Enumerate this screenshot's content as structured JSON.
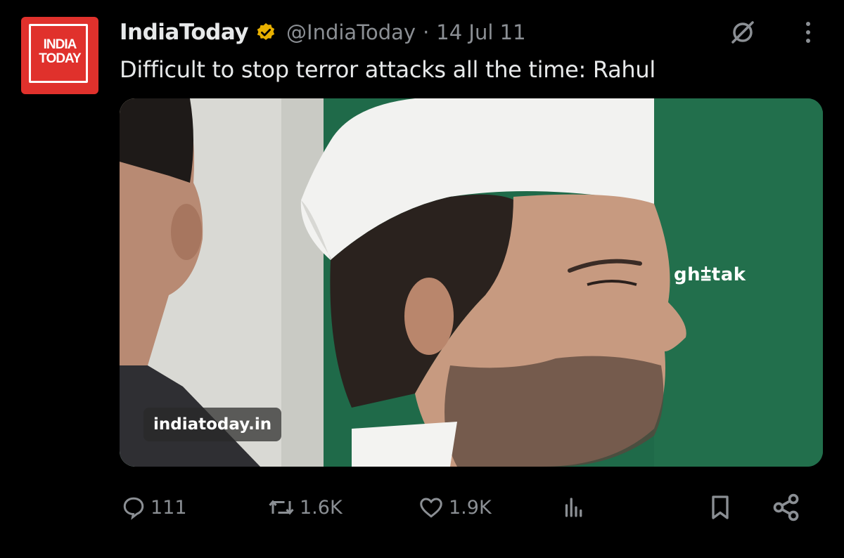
{
  "author": {
    "display_name": "IndiaToday",
    "handle": "@IndiaToday",
    "separator": "·",
    "date": "14 Jul 11",
    "avatar_text_line1": "INDIA",
    "avatar_text_line2": "TODAY",
    "verified_icon": "verified-badge-icon"
  },
  "tweet": {
    "text": "Difficult to stop terror attacks all the time: Rahul"
  },
  "media": {
    "source_label": "indiatoday.in",
    "watermark": "gh⩲tak"
  },
  "actions": {
    "replies": "111",
    "reposts": "1.6K",
    "likes": "1.9K",
    "views": ""
  },
  "colors": {
    "background": "#000000",
    "text_primary": "#e7e9ea",
    "text_secondary": "#8b8f94",
    "brand_red": "#e0312c",
    "verified_gold": "#e8b000"
  }
}
